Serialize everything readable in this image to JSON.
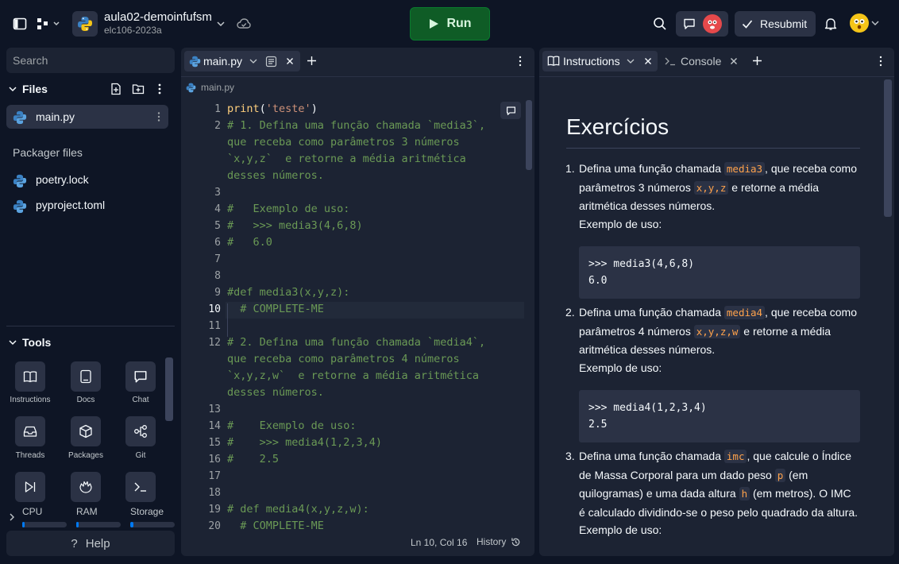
{
  "header": {
    "repl_name": "aula02-demoinfufsm",
    "repl_owner": "elc106-2023a",
    "run_label": "Run",
    "resubmit_label": "Resubmit",
    "icons": [
      "sidebar-toggle-icon",
      "repl-menu-icon",
      "python-logo-icon",
      "chevron-down-icon",
      "cloud-sync-icon",
      "play-icon",
      "search-icon",
      "chat-icon",
      "check-icon",
      "bell-icon",
      "avatar"
    ]
  },
  "sidebar": {
    "search_placeholder": "Search",
    "files_title": "Files",
    "files": [
      {
        "name": "main.py"
      }
    ],
    "packager_title": "Packager files",
    "packager_files": [
      {
        "name": "poetry.lock"
      },
      {
        "name": "pyproject.toml"
      }
    ],
    "tools_title": "Tools",
    "tools": [
      {
        "label": "Instructions",
        "icon": "book-icon"
      },
      {
        "label": "Docs",
        "icon": "tablet-icon"
      },
      {
        "label": "Chat",
        "icon": "chat-icon"
      },
      {
        "label": "Threads",
        "icon": "inbox-icon"
      },
      {
        "label": "Packages",
        "icon": "package-icon"
      },
      {
        "label": "Git",
        "icon": "git-icon"
      },
      {
        "label": "",
        "icon": "debugger-icon"
      },
      {
        "label": "",
        "icon": "shell-icon"
      },
      {
        "label": "",
        "icon": "console-icon"
      }
    ],
    "resources": [
      {
        "label": "CPU",
        "value": 0.02
      },
      {
        "label": "RAM",
        "value": 0.02
      },
      {
        "label": "Storage",
        "value": 0.08
      }
    ],
    "help_label": "Help"
  },
  "editor": {
    "tab_label": "main.py",
    "breadcrumb": "main.py",
    "status_position": "Ln 10, Col 16",
    "history_label": "History",
    "lines": [
      {
        "n": "1",
        "text": "print('teste')"
      },
      {
        "n": "2",
        "text": "# 1. Defina uma função chamada `media3`,"
      },
      {
        "n": "",
        "text": "que receba como parâmetros 3 números"
      },
      {
        "n": "",
        "text": "`x,y,z`  e retorne a média aritmética"
      },
      {
        "n": "",
        "text": "desses números."
      },
      {
        "n": "3",
        "text": ""
      },
      {
        "n": "4",
        "text": "#   Exemplo de uso:"
      },
      {
        "n": "5",
        "text": "#   >>> media3(4,6,8)"
      },
      {
        "n": "6",
        "text": "#   6.0"
      },
      {
        "n": "7",
        "text": ""
      },
      {
        "n": "8",
        "text": ""
      },
      {
        "n": "9",
        "text": "#def media3(x,y,z):"
      },
      {
        "n": "10",
        "text": "  # COMPLETE-ME"
      },
      {
        "n": "11",
        "text": ""
      },
      {
        "n": "12",
        "text": "# 2. Defina uma função chamada `media4`,"
      },
      {
        "n": "",
        "text": "que receba como parâmetros 4 números"
      },
      {
        "n": "",
        "text": "`x,y,z,w`  e retorne a média aritmética"
      },
      {
        "n": "",
        "text": "desses números."
      },
      {
        "n": "13",
        "text": ""
      },
      {
        "n": "14",
        "text": "#    Exemplo de uso:"
      },
      {
        "n": "15",
        "text": "#    >>> media4(1,2,3,4)"
      },
      {
        "n": "16",
        "text": "#    2.5"
      },
      {
        "n": "17",
        "text": ""
      },
      {
        "n": "18",
        "text": ""
      },
      {
        "n": "19",
        "text": "# def media4(x,y,z,w):"
      },
      {
        "n": "20",
        "text": "  # COMPLETE-ME"
      }
    ]
  },
  "instructions": {
    "tab_label": "Instructions",
    "console_tab_label": "Console",
    "heading": "Exercícios",
    "items": [
      {
        "a": "Defina uma função chamada ",
        "c1": "media3",
        "b": ", que receba como parâmetros 3 números ",
        "c2": "x,y,z",
        "d": " e retorne a média aritmética desses números.",
        "example_label": "Exemplo de uso:",
        "code": ">>> media3(4,6,8)\n6.0"
      },
      {
        "a": "Defina uma função chamada ",
        "c1": "media4",
        "b": ", que receba como parâmetros 4 números ",
        "c2": "x,y,z,w",
        "d": " e retorne a média aritmética desses números.",
        "example_label": "Exemplo de uso:",
        "code": ">>> media4(1,2,3,4)\n2.5"
      },
      {
        "a": "Defina uma função chamada ",
        "c1": "imc",
        "b": ", que calcule o Índice de Massa Corporal para um dado peso ",
        "c2": "p",
        "d": " (em quilogramas) e uma dada altura ",
        "c3": "h",
        "e": " (em metros). O IMC é calculado dividindo-se o peso pelo quadrado da altura.",
        "example_label": "Exemplo de uso:"
      }
    ]
  },
  "colors": {
    "bg": "#0e1525",
    "panel": "#1c2333",
    "run": "#0f5c26",
    "accent": "#0079f2",
    "comment": "#6a9955",
    "chip": "#ffa24b"
  }
}
